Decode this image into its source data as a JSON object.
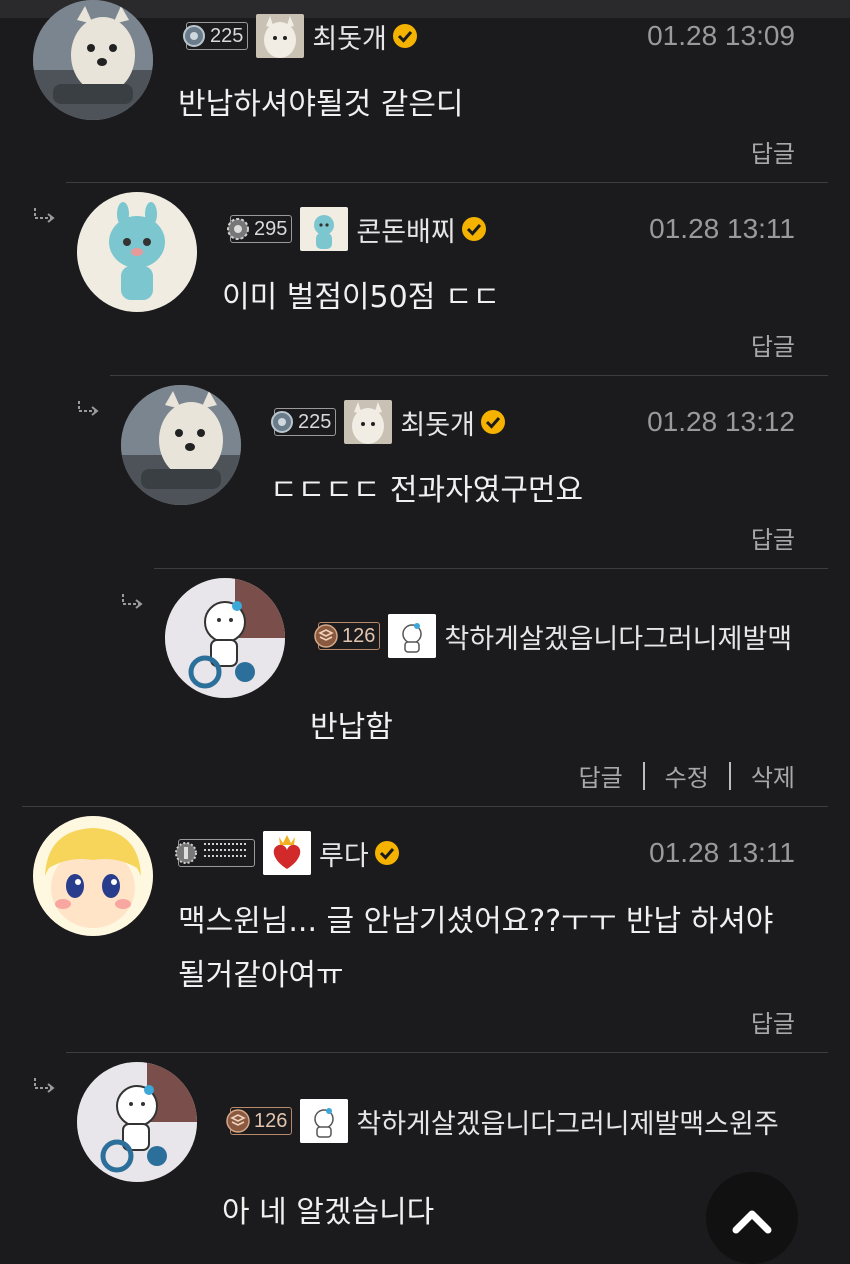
{
  "comments": [
    {
      "level": "225",
      "nickname": "최돗개",
      "time": "01.28 13:09",
      "text": "반납하셔야될것 같은디",
      "actions": [
        "답글"
      ]
    },
    {
      "level": "295",
      "nickname": "콘돈배찌",
      "time": "01.28 13:11",
      "text": "이미 벌점이50점 ㄷㄷ",
      "actions": [
        "답글"
      ]
    },
    {
      "level": "225",
      "nickname": "최돗개",
      "time": "01.28 13:12",
      "text": "ㄷㄷㄷㄷ 전과자였구먼요",
      "actions": [
        "답글"
      ]
    },
    {
      "level": "126",
      "nickname": "착하게살겠읍니다그러니제발맥",
      "time": "",
      "text": "반납함",
      "actions": [
        "답글",
        "수정",
        "삭제"
      ]
    },
    {
      "level": "",
      "nickname": "루다",
      "time": "01.28 13:11",
      "text": "맥스윈님... 글 안남기셨어요??ㅜㅜ 반납 하셔야 될거같아여ㅠ",
      "actions": [
        "답글"
      ]
    },
    {
      "level": "126",
      "nickname": "착하게살겠읍니다그러니제발맥스윈주",
      "time": "",
      "text": "아 네 알겠습니다",
      "actions": []
    }
  ],
  "icons": {
    "verified": "verified-check-icon",
    "reply": "reply-arrow-icon",
    "scroll_top": "chevron-up-icon"
  },
  "colors": {
    "background": "#1b1b1d",
    "verified": "#f5b300",
    "divider": "#3d3d40"
  }
}
